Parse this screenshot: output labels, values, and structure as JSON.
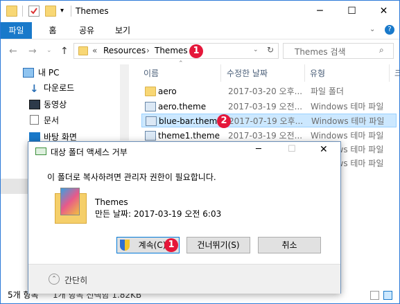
{
  "window": {
    "title": "Themes"
  },
  "ribbon": {
    "tabs": [
      "파일",
      "홈",
      "공유",
      "보기"
    ]
  },
  "navbar": {
    "path": [
      "«",
      "Resources",
      "Themes"
    ],
    "search_placeholder": "Themes 검색"
  },
  "nav_pane": {
    "items": [
      "내 PC",
      "다운로드",
      "동영상",
      "문서",
      "바탕 화면"
    ]
  },
  "columns": [
    "이름",
    "수정한 날짜",
    "유형",
    "크"
  ],
  "files": [
    {
      "name": "aero",
      "date": "2017-03-20 오후...",
      "type": "파일 폴더"
    },
    {
      "name": "aero.theme",
      "date": "2017-03-19 오전...",
      "type": "Windows 테마 파일"
    },
    {
      "name": "blue-bar.theme",
      "date": "2017-07-19 오후...",
      "type": "Windows 테마 파일"
    },
    {
      "name": "theme1.theme",
      "date": "2017-03-19 오전...",
      "type": "Windows 테마 파일"
    },
    {
      "name": "",
      "date": "",
      "type": "Windows 테마 파일"
    },
    {
      "name": "",
      "date": "",
      "type": "Windows 테마 파일"
    }
  ],
  "status": {
    "count": "5개 항목",
    "selection": "1개 항목 선택함 1.82KB"
  },
  "badges": {
    "one": "1",
    "two": "2"
  },
  "dialog": {
    "title": "대상 폴더 액세스 거부",
    "message": "이 폴더로 복사하려면 관리자 권한이 필요합니다.",
    "file_name": "Themes",
    "file_date": "만든 날짜: 2017-03-19 오전 6:03",
    "continue_label": "계속(C)",
    "skip_label": "건너뛰기(S)",
    "cancel_label": "취소",
    "footer_label": "간단히"
  },
  "colors": {
    "accent": "#1979ca",
    "badge": "#e5173a",
    "selection": "#cce8ff"
  }
}
